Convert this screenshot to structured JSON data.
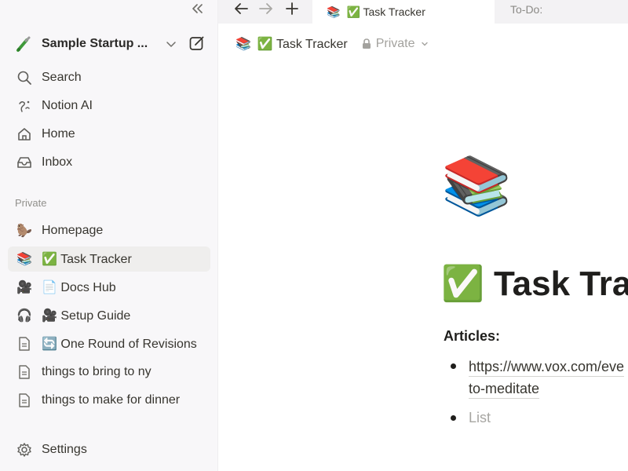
{
  "sidebar": {
    "workspace_name": "Sample Startup ...",
    "nav": [
      {
        "label": "Search",
        "icon": "search-icon"
      },
      {
        "label": "Notion AI",
        "icon": "notion-ai-icon"
      },
      {
        "label": "Home",
        "icon": "home-icon"
      },
      {
        "label": "Inbox",
        "icon": "inbox-icon"
      }
    ],
    "section_label": "Private",
    "pages": [
      {
        "label": "Homepage",
        "icon": "🦫"
      },
      {
        "label": "✅ Task Tracker",
        "icon": "📚"
      },
      {
        "label": "📄 Docs Hub",
        "icon": "🎥"
      },
      {
        "label": "🎥 Setup Guide",
        "icon": "🎧"
      },
      {
        "label": "🔄 One Round of Revisions",
        "icon": "page-icon"
      },
      {
        "label": "things to bring to ny",
        "icon": "page-icon"
      },
      {
        "label": "things to make for dinner",
        "icon": "page-icon"
      }
    ],
    "settings_label": "Settings"
  },
  "tabs": {
    "active": {
      "emoji": "📚",
      "title": "✅ Task Tracker"
    },
    "inactive": {
      "title": "To-Do:"
    }
  },
  "breadcrumb": {
    "emoji": "📚",
    "title": "✅ Task Tracker",
    "privacy": "Private"
  },
  "page": {
    "icon": "📚",
    "title": "✅ Task Tracker",
    "heading": "Articles:",
    "link_line1": "https://www.vox.com/eve",
    "link_line2": "to-meditate",
    "list_placeholder": "List"
  },
  "colors": {
    "sidebar_bg": "#f8f7f9",
    "active_item_bg": "#efeeed",
    "text": "#37352f",
    "muted": "#91908c"
  }
}
